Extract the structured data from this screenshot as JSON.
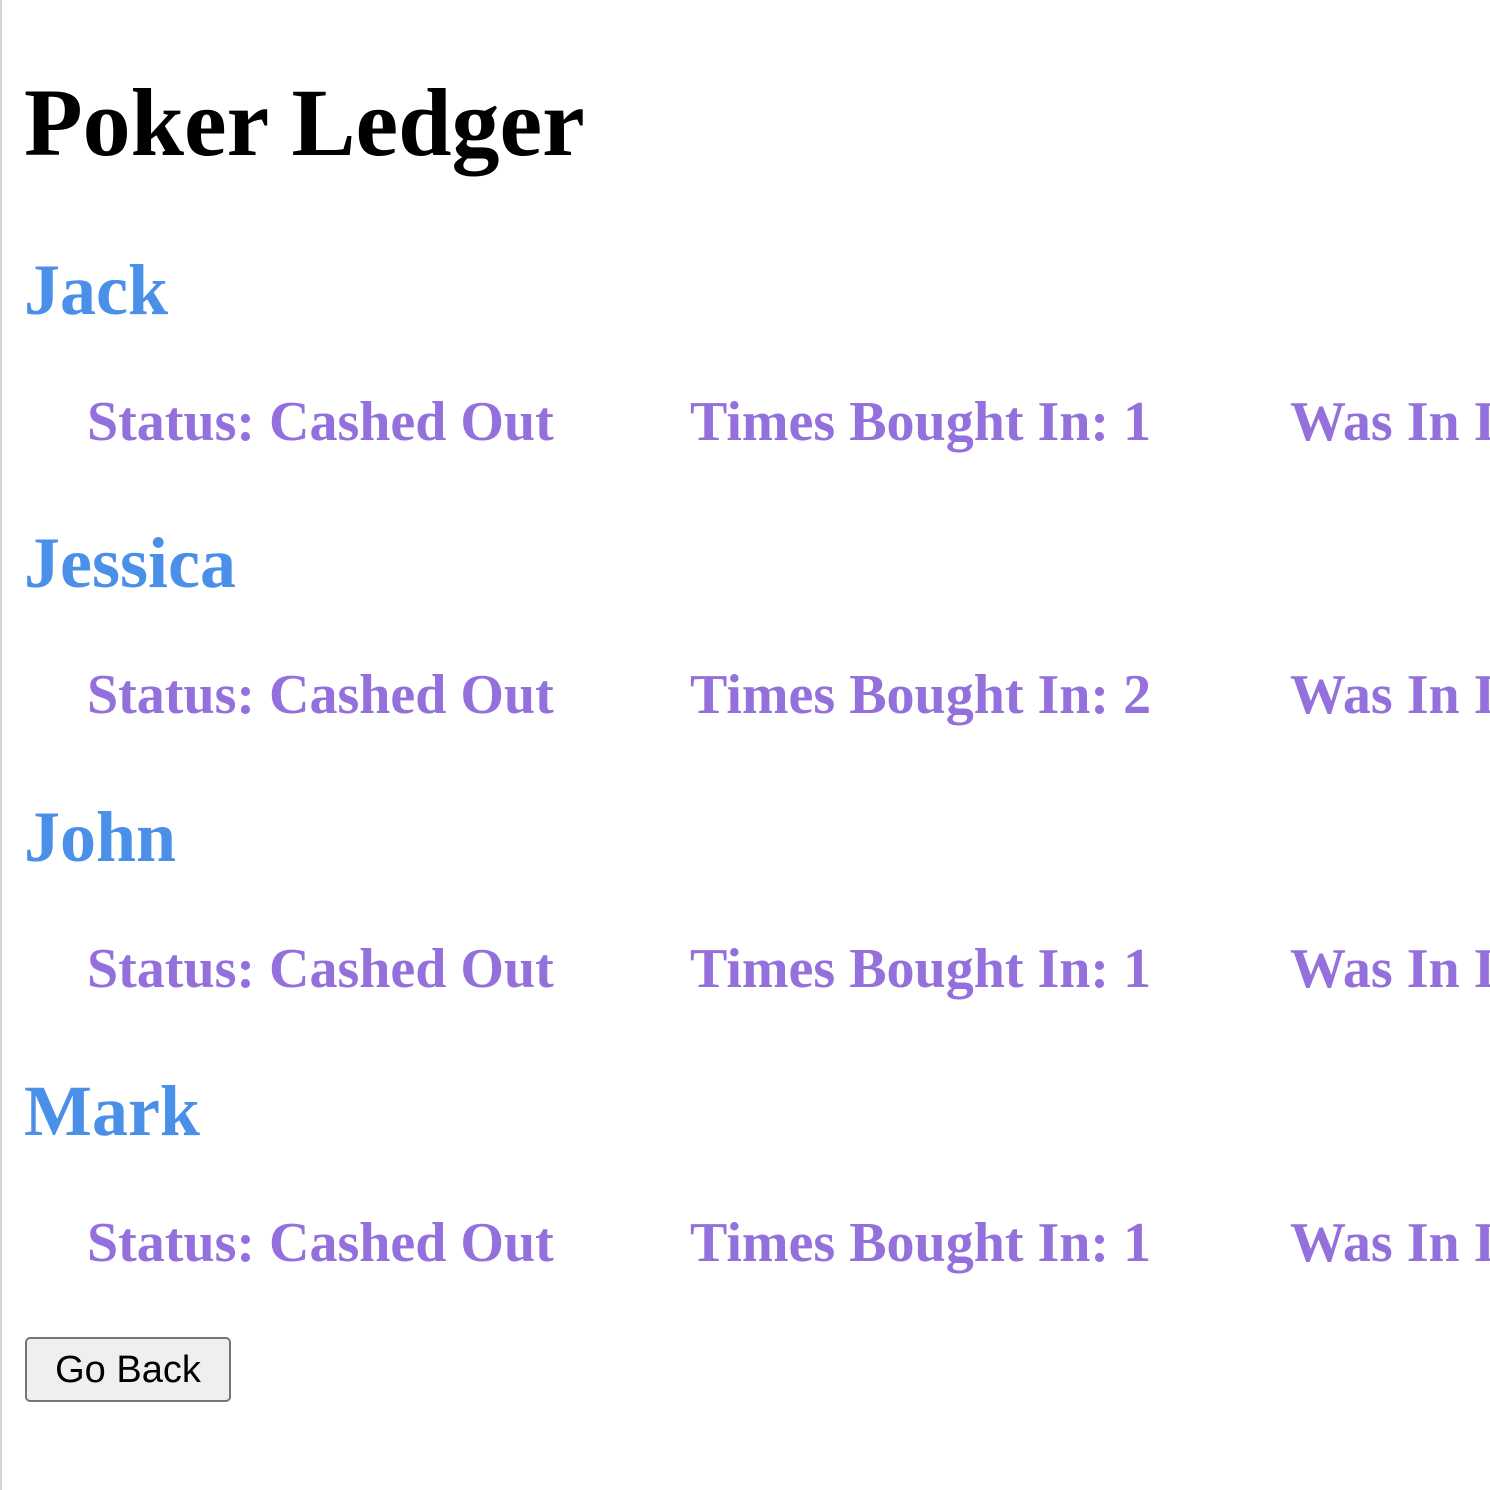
{
  "page": {
    "title": "Poker Ledger"
  },
  "colors": {
    "name": "#4a8fe8",
    "stat": "#9370db"
  },
  "players": [
    {
      "name": "Jack",
      "status_label": "Status: ",
      "status_value": "Cashed Out",
      "buyins_label": "Times Bought In: ",
      "buyins_value": "1",
      "was_in_text": "Was In I"
    },
    {
      "name": "Jessica",
      "status_label": "Status: ",
      "status_value": "Cashed Out",
      "buyins_label": "Times Bought In: ",
      "buyins_value": "2",
      "was_in_text": "Was In I"
    },
    {
      "name": "John",
      "status_label": "Status: ",
      "status_value": "Cashed Out",
      "buyins_label": "Times Bought In: ",
      "buyins_value": "1",
      "was_in_text": "Was In I"
    },
    {
      "name": "Mark",
      "status_label": "Status: ",
      "status_value": "Cashed Out",
      "buyins_label": "Times Bought In: ",
      "buyins_value": "1",
      "was_in_text": "Was In I"
    }
  ],
  "actions": {
    "go_back_label": "Go Back"
  }
}
